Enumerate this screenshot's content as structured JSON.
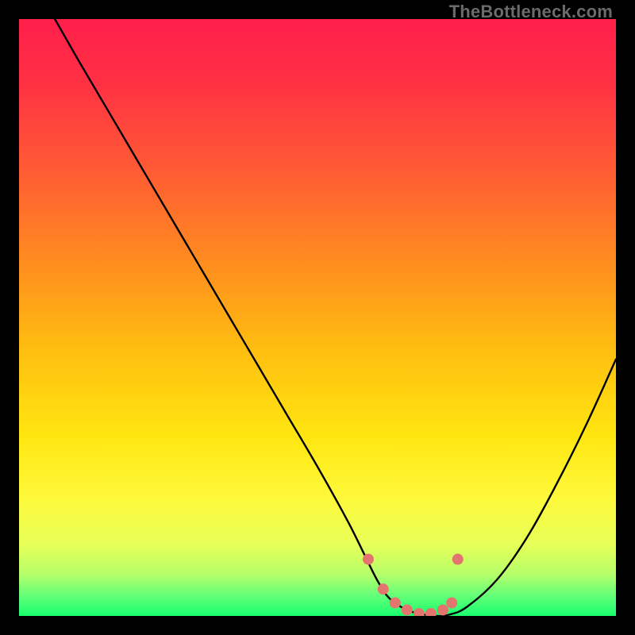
{
  "watermark": "TheBottleneck.com",
  "chart_data": {
    "type": "line",
    "title": "",
    "xlabel": "",
    "ylabel": "",
    "xlim": [
      0,
      100
    ],
    "ylim": [
      0,
      100
    ],
    "grid": false,
    "legend": false,
    "series": [
      {
        "name": "curve",
        "color": "#000000",
        "x": [
          6,
          10,
          15,
          20,
          25,
          30,
          35,
          40,
          45,
          50,
          55,
          58,
          60,
          62,
          65,
          68,
          70,
          72,
          75,
          80,
          85,
          90,
          95,
          100
        ],
        "y": [
          100,
          93,
          84.5,
          76,
          67.5,
          59,
          50.5,
          42,
          33.5,
          25,
          16,
          10,
          6,
          3,
          1,
          0.2,
          0,
          0.2,
          1.5,
          6,
          13,
          22,
          32,
          43
        ]
      },
      {
        "name": "highlight-dots",
        "color": "#e4746e",
        "type": "scatter",
        "x": [
          58.5,
          61,
          63,
          65,
          67,
          69,
          71,
          72.5,
          73.5
        ],
        "y": [
          9.5,
          4.5,
          2.2,
          1.0,
          0.4,
          0.4,
          1.0,
          2.2,
          9.5
        ]
      }
    ],
    "background_gradient": {
      "stops": [
        {
          "offset": 0.0,
          "color": "#ff1f4b"
        },
        {
          "offset": 0.1,
          "color": "#ff2f44"
        },
        {
          "offset": 0.25,
          "color": "#ff5a34"
        },
        {
          "offset": 0.4,
          "color": "#ff8a20"
        },
        {
          "offset": 0.55,
          "color": "#ffbd10"
        },
        {
          "offset": 0.7,
          "color": "#ffe610"
        },
        {
          "offset": 0.8,
          "color": "#fff93a"
        },
        {
          "offset": 0.88,
          "color": "#e7ff58"
        },
        {
          "offset": 0.93,
          "color": "#b6ff6a"
        },
        {
          "offset": 0.965,
          "color": "#66ff78"
        },
        {
          "offset": 1.0,
          "color": "#17ff6e"
        }
      ]
    }
  }
}
